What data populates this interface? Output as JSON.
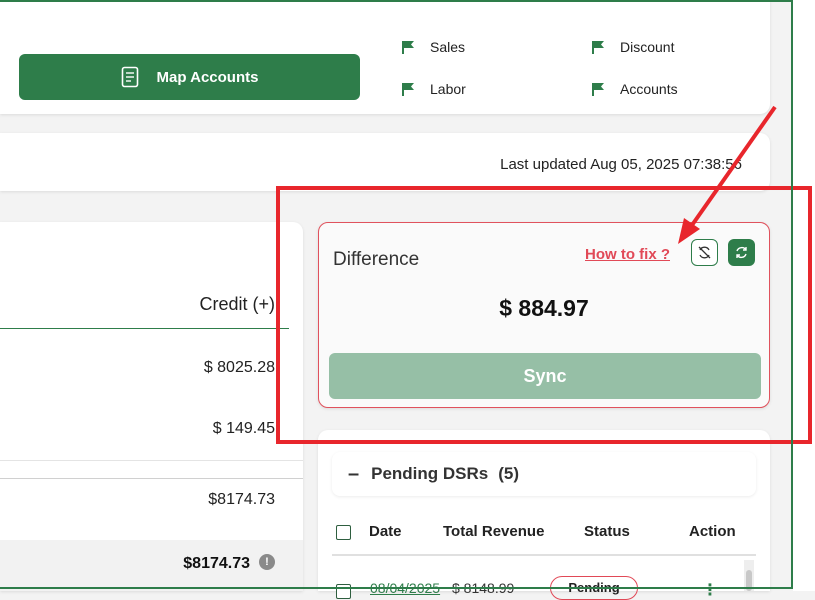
{
  "top": {
    "map_button_label": "Map Accounts",
    "flags": [
      "Sales",
      "Discount",
      "Labor",
      "Accounts"
    ]
  },
  "status": {
    "last_updated": "Last updated Aug 05, 2025 07:38:56"
  },
  "table": {
    "credit_header": "Credit (+)",
    "amounts": [
      "$ 8025.28",
      "$ 149.45"
    ],
    "subtotal": "$8174.73",
    "total": "$8174.73",
    "info_icon": "!"
  },
  "difference": {
    "title": "Difference",
    "how_to_fix": "How to fix ?",
    "amount": "$ 884.97",
    "sync_label": "Sync"
  },
  "pending": {
    "title": "Pending DSRs",
    "count": "(5)",
    "minus": "–",
    "columns": [
      "Date",
      "Total Revenue",
      "Status",
      "Action"
    ],
    "row": {
      "date": "08/04/2025",
      "revenue": "$ 8148.99",
      "status": "Pending",
      "action": "⋮"
    }
  },
  "colors": {
    "brand_green": "#2e7d4a",
    "alert_red": "#e14957",
    "annotation_red": "#e8262c"
  }
}
